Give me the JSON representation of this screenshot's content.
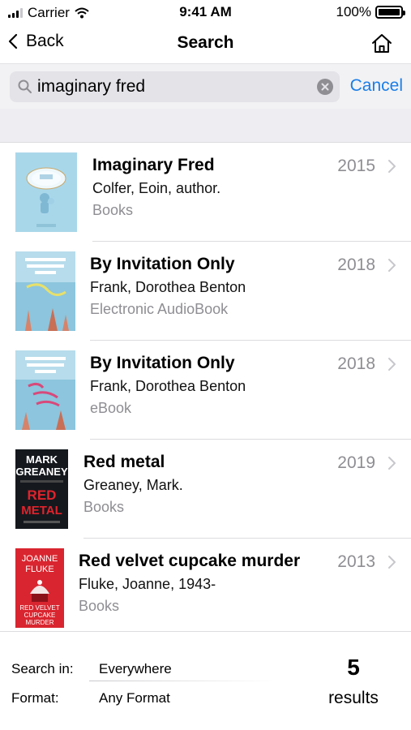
{
  "status_bar": {
    "carrier": "Carrier",
    "time": "9:41 AM",
    "battery": "100%",
    "battery_level": 1.0
  },
  "nav": {
    "back_label": "Back",
    "title": "Search",
    "home_icon": "home-icon"
  },
  "search": {
    "query": "imaginary fred",
    "cancel_label": "Cancel"
  },
  "results": [
    {
      "title": "Imaginary Fred",
      "author": "Colfer, Eoin, author.",
      "format": "Books",
      "year": "2015",
      "cover_color": "#a9d7ea"
    },
    {
      "title": "By Invitation Only",
      "author": "Frank, Dorothea Benton",
      "format": "Electronic AudioBook",
      "year": "2018",
      "cover_color": "#8cc5dd"
    },
    {
      "title": "By Invitation Only",
      "author": "Frank, Dorothea Benton",
      "format": "eBook",
      "year": "2018",
      "cover_color": "#8cc5dd"
    },
    {
      "title": "Red metal",
      "author": "Greaney, Mark.",
      "format": "Books",
      "year": "2019",
      "cover_color": "#15191e",
      "cover_text": {
        "line1": "MARK",
        "line2": "GREANEY",
        "line3": "RED",
        "line4": "METAL"
      }
    },
    {
      "title": "Red velvet cupcake murder",
      "author": "Fluke, Joanne, 1943-",
      "format": "Books",
      "year": "2013",
      "cover_color": "#d9252f",
      "cover_text": {
        "line1": "JOANNE",
        "line2": "FLUKE",
        "line3": "RED VELVET",
        "line4": "CUPCAKE",
        "line5": "MURDER"
      }
    }
  ],
  "footer": {
    "search_in_label": "Search in:",
    "search_in_value": "Everywhere",
    "format_label": "Format:",
    "format_value": "Any Format",
    "count": "5",
    "results_label": "results"
  },
  "colors": {
    "accent": "#1a7ee8",
    "secondary_text": "#8e8e93",
    "separator": "#dcdce0"
  }
}
